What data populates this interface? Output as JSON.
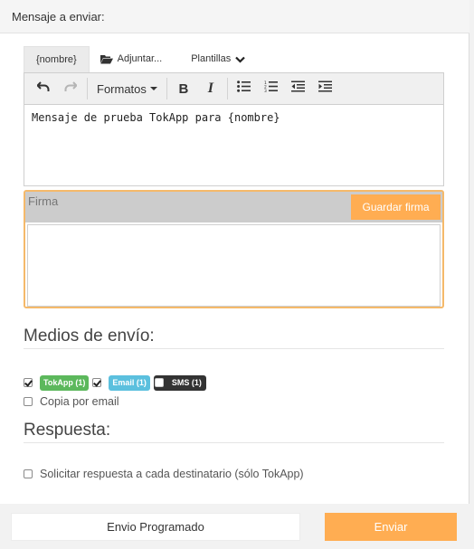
{
  "header": {
    "title": "Mensaje a enviar:"
  },
  "tabs": [
    {
      "label": "{nombre}",
      "icon": ""
    },
    {
      "label": "Adjuntar...",
      "icon": "folder-open-icon"
    },
    {
      "label": "Plantillas",
      "icon": "chevron-down-icon"
    }
  ],
  "toolbar": {
    "formats_label": "Formatos",
    "bold_label": "B",
    "italic_label": "I"
  },
  "editor": {
    "content": "Mensaje de prueba TokApp para {nombre}"
  },
  "firma": {
    "label": "Firma",
    "save_label": "Guardar firma"
  },
  "medios": {
    "title": "Medios de envío:",
    "options": [
      {
        "label": "TokApp (1)",
        "checked": true,
        "color": "#5cb85c"
      },
      {
        "label": "Email (1)",
        "checked": true,
        "color": "#5bc0de"
      },
      {
        "label": "SMS (1)",
        "checked": false,
        "color": "#333333"
      }
    ],
    "copy_label": "Copia por email"
  },
  "respuesta": {
    "title": "Respuesta:",
    "request_label": "Solicitar respuesta a cada destinatario (sólo TokApp)"
  },
  "footer": {
    "scheduled_label": "Envio Programado",
    "send_label": "Enviar"
  },
  "colors": {
    "accent": "#ffad52",
    "firma_border": "#f5b96a"
  }
}
